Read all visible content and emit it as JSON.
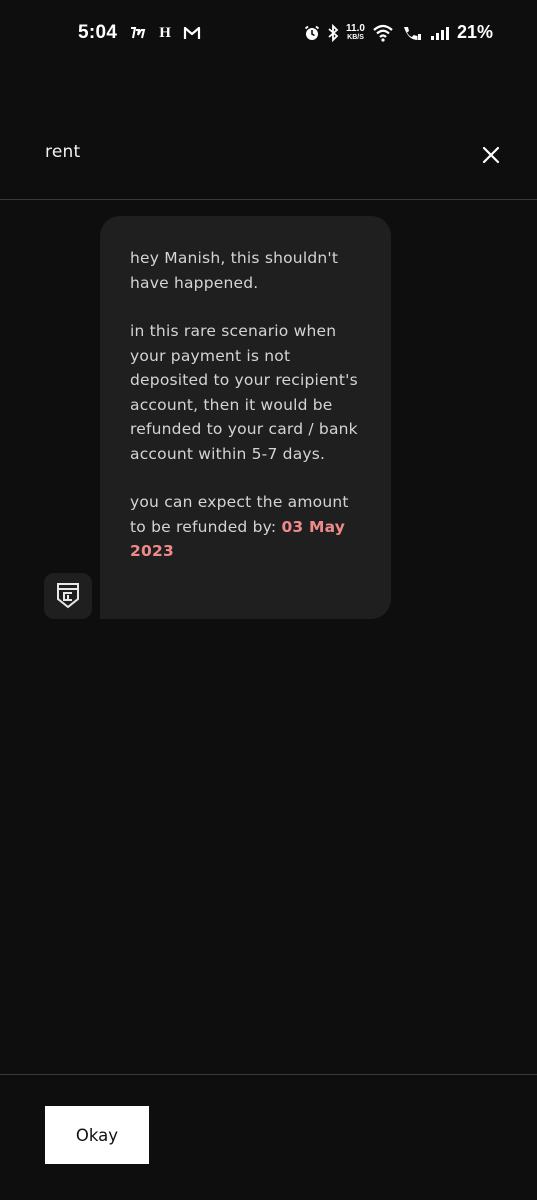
{
  "status_bar": {
    "time": "5:04",
    "app_glyph_h": "H",
    "network_speed_value": "11.0",
    "network_speed_unit": "KB/S",
    "battery": "21%"
  },
  "header": {
    "title": "rent"
  },
  "message": {
    "greeting": "hey Manish, this shouldn't have happened.",
    "body": "in this rare scenario when your payment is not deposited to your recipient's account, then it would be refunded to your card / bank account within 5-7 days.",
    "expect_prefix": "you can expect the amount to be refunded by: ",
    "refund_date": "03 May 2023",
    "highlight_color": "#f08a8a"
  },
  "footer": {
    "okay_label": "Okay"
  }
}
